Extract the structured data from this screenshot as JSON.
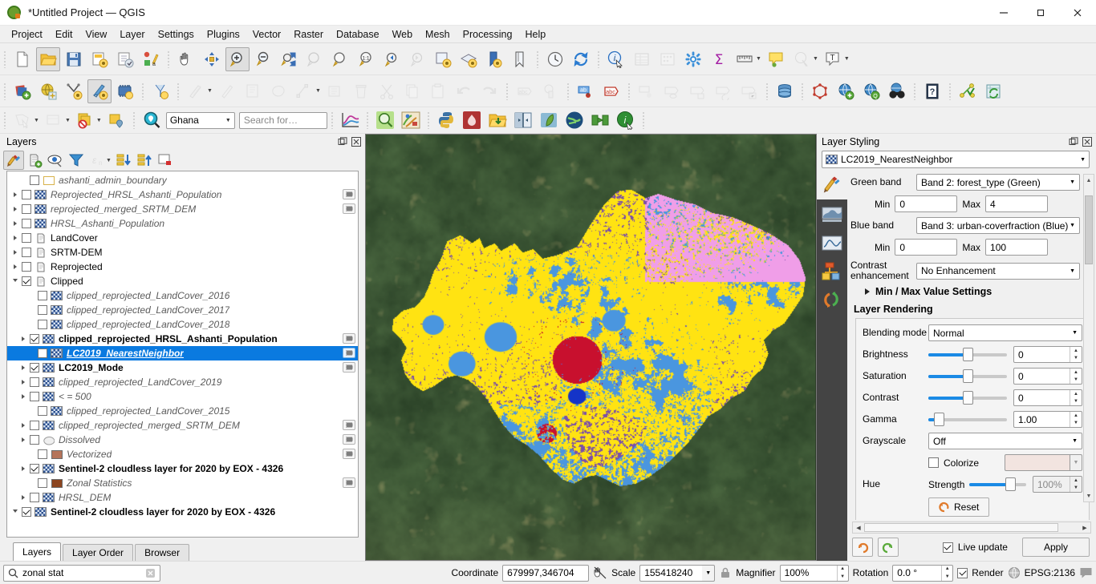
{
  "window": {
    "title": "*Untitled Project — QGIS",
    "minimize": "—",
    "maximize": "❐",
    "close": "✕"
  },
  "menubar": [
    {
      "label": "Project"
    },
    {
      "label": "Edit"
    },
    {
      "label": "View"
    },
    {
      "label": "Layer"
    },
    {
      "label": "Settings"
    },
    {
      "label": "Plugins"
    },
    {
      "label": "Vector"
    },
    {
      "label": "Raster"
    },
    {
      "label": "Database"
    },
    {
      "label": "Web"
    },
    {
      "label": "Mesh"
    },
    {
      "label": "Processing"
    },
    {
      "label": "Help"
    }
  ],
  "toolbar_project": [
    {
      "name": "new-project-icon",
      "tip": "New Project"
    },
    {
      "name": "open-project-icon",
      "tip": "Open Project"
    },
    {
      "name": "save-project-icon",
      "tip": "Save Project"
    },
    {
      "name": "save-project-as-icon",
      "tip": "Save Project As"
    },
    {
      "name": "new-print-layout-icon",
      "tip": "New Print Layout"
    },
    {
      "name": "style-manager-icon",
      "tip": "Style Manager"
    }
  ],
  "toolbar_navigation": [
    {
      "name": "pan-map-icon",
      "tip": "Pan Map"
    },
    {
      "name": "pan-to-selection-icon",
      "tip": "Pan Map to Selection"
    },
    {
      "name": "zoom-in-icon",
      "tip": "Zoom In",
      "active": true
    },
    {
      "name": "zoom-out-icon",
      "tip": "Zoom Out"
    },
    {
      "name": "zoom-full-icon",
      "tip": "Zoom Full"
    },
    {
      "name": "zoom-to-selection-icon",
      "tip": "Zoom to Selection",
      "disabled": true
    },
    {
      "name": "zoom-to-layer-icon",
      "tip": "Zoom to Layer"
    },
    {
      "name": "zoom-native-icon",
      "tip": "Zoom to Native Resolution"
    },
    {
      "name": "zoom-last-icon",
      "tip": "Zoom Last"
    },
    {
      "name": "zoom-next-icon",
      "tip": "Zoom Next",
      "disabled": true
    },
    {
      "name": "new-map-view-icon",
      "tip": "New Map View"
    },
    {
      "name": "new-3d-map-view-icon",
      "tip": "New 3D Map View"
    },
    {
      "name": "refresh-bookmark-icon",
      "tip": "Show Spatial Bookmarks"
    },
    {
      "name": "new-bookmark-icon",
      "tip": "New Spatial Bookmark"
    },
    {
      "name": "temporal-controller-icon",
      "tip": "Temporal Controller Panel"
    },
    {
      "name": "refresh-icon",
      "tip": "Refresh"
    }
  ],
  "toolbar_attributes": [
    {
      "name": "identify-features-icon",
      "tip": "Identify Features"
    },
    {
      "name": "open-attribute-table-icon",
      "tip": "Open Attribute Table",
      "disabled": true
    },
    {
      "name": "statistical-summary-icon",
      "tip": "Statistical Summary",
      "disabled": true
    },
    {
      "name": "processing-toolbox-icon",
      "tip": "Processing Toolbox"
    },
    {
      "name": "field-calculator-icon",
      "tip": "Field Calculator"
    },
    {
      "name": "measure-line-icon",
      "tip": "Measure Line"
    },
    {
      "name": "map-tips-icon",
      "tip": "Show Map Tips"
    },
    {
      "name": "select-features-icon",
      "tip": "Select Features",
      "disabled": true
    },
    {
      "name": "annotation-text-icon",
      "tip": "Text Annotation"
    }
  ],
  "toolbar_manage_layers": [
    {
      "name": "add-vector-layer-icon",
      "tip": "Add Vector Layer"
    },
    {
      "name": "add-raster-layer-icon",
      "tip": "Add Raster Layer"
    },
    {
      "name": "add-delimited-text-layer-icon",
      "tip": "Add Delimited Text Layer"
    },
    {
      "name": "new-shapefile-layer-icon",
      "tip": "New Shapefile Layer",
      "active": true
    },
    {
      "name": "add-mesh-layer-icon",
      "tip": "Add Mesh Layer"
    },
    {
      "name": "new-virtual-layer-icon",
      "tip": "New Virtual Layer"
    }
  ],
  "toolbar_digitizing": [
    {
      "name": "current-edits-icon",
      "tip": "Current Edits",
      "disabled": true
    },
    {
      "name": "toggle-editing-icon",
      "tip": "Toggle Editing",
      "disabled": true
    },
    {
      "name": "save-layer-edits-icon",
      "tip": "Save Layer Edits",
      "disabled": true
    },
    {
      "name": "add-polygon-feature-icon",
      "tip": "Add Polygon Feature",
      "disabled": true
    },
    {
      "name": "vertex-tool-icon",
      "tip": "Vertex Tool",
      "disabled": true
    },
    {
      "name": "modify-attributes-icon",
      "tip": "Modify Attributes of Features",
      "disabled": true
    },
    {
      "name": "delete-selected-icon",
      "tip": "Delete Selected",
      "disabled": true
    },
    {
      "name": "cut-features-icon",
      "tip": "Cut Features",
      "disabled": true
    },
    {
      "name": "copy-features-icon",
      "tip": "Copy Features",
      "disabled": true
    },
    {
      "name": "paste-features-icon",
      "tip": "Paste Features",
      "disabled": true
    },
    {
      "name": "undo-icon",
      "tip": "Undo",
      "disabled": true
    },
    {
      "name": "redo-icon",
      "tip": "Redo",
      "disabled": true
    }
  ],
  "toolbar_label": [
    {
      "name": "layer-labeling-options-icon",
      "tip": "Layer Labeling Options",
      "disabled": true
    },
    {
      "name": "layer-diagram-options-icon",
      "tip": "Layer Diagram Options",
      "disabled": true
    },
    {
      "name": "pin-labels-icon",
      "tip": "Pin Labels"
    },
    {
      "name": "highlight-pinned-labels-icon",
      "tip": "Highlight Pinned Labels"
    },
    {
      "name": "move-label-icon",
      "tip": "Move Label",
      "disabled": true
    },
    {
      "name": "show-hide-labels-icon",
      "tip": "Show/Hide Labels",
      "disabled": true
    },
    {
      "name": "rotate-label-icon",
      "tip": "Rotate Label",
      "disabled": true
    },
    {
      "name": "change-label-icon",
      "tip": "Change Label",
      "disabled": true
    },
    {
      "name": "label-properties-icon",
      "tip": "Label Properties",
      "disabled": true
    }
  ],
  "toolbar_database_web": [
    {
      "name": "database-manager-icon",
      "tip": "DB Manager"
    },
    {
      "name": "georeferencer-icon",
      "tip": "Georeferencer"
    },
    {
      "name": "metasearch-add-icon",
      "tip": "MetaSearch"
    },
    {
      "name": "qgis-globe-icon",
      "tip": "Globe"
    },
    {
      "name": "binoculars-icon",
      "tip": "Search"
    },
    {
      "name": "help-contents-icon",
      "tip": "Help Contents"
    },
    {
      "name": "plugins-manager-icon",
      "tip": "Plugins"
    },
    {
      "name": "refresh-layer-icon",
      "tip": "Refresh Layer"
    }
  ],
  "toolbar_selection": [
    {
      "name": "select-by-area-icon",
      "tip": "Select Features by Area",
      "disabled": true
    },
    {
      "name": "select-by-value-icon",
      "tip": "Select Features by Value",
      "disabled": true
    },
    {
      "name": "deselect-features-icon",
      "tip": "Deselect Features from All Layers"
    },
    {
      "name": "select-value-icon",
      "tip": "Select Value"
    }
  ],
  "gps_toolbar": {
    "locator_icon": "magnifier-place-icon",
    "region_selected": "Ghana",
    "search_placeholder": "Search for…"
  },
  "toolbar_plugins": [
    {
      "name": "plot-chart-icon",
      "tip": "Data Plotly"
    },
    {
      "name": "search-layers-icon",
      "tip": "Search Layers"
    },
    {
      "name": "qgis2web-icon",
      "tip": "qgis2web"
    },
    {
      "name": "python-console-icon",
      "tip": "Python Console"
    },
    {
      "name": "freehand-raster-icon",
      "tip": "Freehand Raster Georeferencer"
    },
    {
      "name": "open-data-source-icon",
      "tip": "Open Data File"
    },
    {
      "name": "swipe-tool-icon",
      "tip": "Map Swipe Tool"
    },
    {
      "name": "leaflet-icon",
      "tip": "Leaflet Map"
    },
    {
      "name": "qgis-globe-plugin-icon",
      "tip": "Globe Plugin"
    },
    {
      "name": "mmqgis-icon",
      "tip": "MMQGIS"
    },
    {
      "name": "about-plugin-icon",
      "tip": "About"
    }
  ],
  "layers_panel": {
    "title": "Layers",
    "undock_icon": "undock-icon",
    "close_icon": "close-icon",
    "toolbar": [
      {
        "name": "open-layer-styling-panel-icon",
        "tip": "Open the Layer Styling panel",
        "active": true
      },
      {
        "name": "add-group-icon",
        "tip": "Add Group"
      },
      {
        "name": "manage-map-themes-icon",
        "tip": "Manage Map Themes"
      },
      {
        "name": "filter-legend-icon",
        "tip": "Filter Legend"
      },
      {
        "name": "filter-legend-expression-icon",
        "tip": "Filter Legend by Expression",
        "disabled": true
      },
      {
        "name": "expand-all-icon",
        "tip": "Expand All"
      },
      {
        "name": "collapse-all-icon",
        "tip": "Collapse All"
      },
      {
        "name": "remove-layer-icon",
        "tip": "Remove Layer/Group"
      }
    ],
    "items": [
      {
        "label": "ashanti_admin_boundary",
        "icon": "vector-outline-swatch",
        "checked": false,
        "style": "italic",
        "indent": 1,
        "expander": "none",
        "dock": false
      },
      {
        "label": "Reprojected_HRSL_Ashanti_Population",
        "icon": "raster",
        "checked": false,
        "style": "italic",
        "indent": 0,
        "expander": "closed",
        "dock": true
      },
      {
        "label": "reprojected_merged_SRTM_DEM",
        "icon": "raster",
        "checked": false,
        "style": "italic",
        "indent": 0,
        "expander": "closed",
        "dock": true
      },
      {
        "label": "HRSL_Ashanti_Population",
        "icon": "raster",
        "checked": false,
        "style": "italic",
        "indent": 0,
        "expander": "closed",
        "dock": false
      },
      {
        "label": "LandCover",
        "icon": "group",
        "checked": false,
        "style": "plain",
        "indent": 0,
        "expander": "closed",
        "dock": false
      },
      {
        "label": "SRTM-DEM",
        "icon": "group",
        "checked": false,
        "style": "plain",
        "indent": 0,
        "expander": "closed",
        "dock": false
      },
      {
        "label": "Reprojected",
        "icon": "group",
        "checked": false,
        "style": "plain",
        "indent": 0,
        "expander": "closed",
        "dock": false
      },
      {
        "label": "Clipped",
        "icon": "group",
        "checked": true,
        "style": "plain",
        "indent": 0,
        "expander": "open",
        "dock": false
      },
      {
        "label": "clipped_reprojected_LandCover_2016",
        "icon": "raster",
        "checked": false,
        "style": "italic",
        "indent": 2,
        "expander": "none",
        "dock": false
      },
      {
        "label": "clipped_reprojected_LandCover_2017",
        "icon": "raster",
        "checked": false,
        "style": "italic",
        "indent": 2,
        "expander": "none",
        "dock": false
      },
      {
        "label": "clipped_reprojected_LandCover_2018",
        "icon": "raster",
        "checked": false,
        "style": "italic",
        "indent": 2,
        "expander": "none",
        "dock": false
      },
      {
        "label": "clipped_reprojected_HRSL_Ashanti_Population",
        "icon": "raster",
        "checked": true,
        "style": "bold",
        "indent": 1,
        "expander": "closed",
        "dock": true
      },
      {
        "label": "LC2019_NearestNeighbor",
        "icon": "raster",
        "checked": false,
        "style": "selected",
        "indent": 2,
        "expander": "none",
        "dock": true,
        "selected": true
      },
      {
        "label": "LC2019_Mode",
        "icon": "raster",
        "checked": true,
        "style": "bold",
        "indent": 1,
        "expander": "closed",
        "dock": true
      },
      {
        "label": "clipped_reprojected_LandCover_2019",
        "icon": "raster",
        "checked": false,
        "style": "italic",
        "indent": 1,
        "expander": "closed",
        "dock": false
      },
      {
        "label": "< = 500",
        "icon": "raster",
        "checked": false,
        "style": "italic",
        "indent": 1,
        "expander": "closed",
        "dock": false
      },
      {
        "label": "clipped_reprojected_LandCover_2015",
        "icon": "raster",
        "checked": false,
        "style": "italic",
        "indent": 2,
        "expander": "none",
        "dock": false
      },
      {
        "label": "clipped_reprojected_merged_SRTM_DEM",
        "icon": "raster",
        "checked": false,
        "style": "italic",
        "indent": 1,
        "expander": "closed",
        "dock": true
      },
      {
        "label": "Dissolved",
        "icon": "polygon-outline",
        "checked": false,
        "style": "italic",
        "indent": 1,
        "expander": "closed",
        "dock": true
      },
      {
        "label": "Vectorized",
        "icon": "swatch-brown-light",
        "checked": false,
        "style": "italic",
        "indent": 2,
        "expander": "none",
        "dock": true
      },
      {
        "label": "Sentinel-2 cloudless layer for 2020 by EOX - 4326",
        "icon": "raster",
        "checked": true,
        "style": "bold",
        "indent": 1,
        "expander": "closed",
        "dock": false
      },
      {
        "label": "Zonal Statistics",
        "icon": "swatch-brown-dark",
        "checked": false,
        "style": "italic",
        "indent": 2,
        "expander": "none",
        "dock": true
      },
      {
        "label": "HRSL_DEM",
        "icon": "raster",
        "checked": false,
        "style": "italic",
        "indent": 1,
        "expander": "closed",
        "dock": false
      },
      {
        "label": "Sentinel-2 cloudless layer for 2020 by EOX - 4326",
        "icon": "raster",
        "checked": true,
        "style": "bold",
        "indent": 0,
        "expander": "open",
        "dock": false
      }
    ],
    "tabs": [
      {
        "label": "Layers",
        "active": true
      },
      {
        "label": "Layer Order",
        "active": false
      },
      {
        "label": "Browser",
        "active": false
      }
    ]
  },
  "style_panel": {
    "title": "Layer Styling",
    "undock_icon": "undock-icon",
    "close_icon": "close-icon",
    "layer_selected": "LC2019_NearestNeighbor",
    "rail": [
      {
        "name": "symbology-icon",
        "active": false
      },
      {
        "name": "transparency-icon",
        "active": false
      },
      {
        "name": "histogram-icon",
        "active": false
      },
      {
        "name": "rendering-icon",
        "active": false
      },
      {
        "name": "undo-redo-history-icon",
        "active": false
      }
    ],
    "green_band": {
      "label": "Green band",
      "value": "Band 2: forest_type (Green)",
      "min_label": "Min",
      "min": "0",
      "max_label": "Max",
      "max": "4"
    },
    "blue_band": {
      "label": "Blue band",
      "value": "Band 3: urban-coverfraction (Blue)",
      "min_label": "Min",
      "min": "0",
      "max_label": "Max",
      "max": "100"
    },
    "contrast": {
      "label": "Contrast enhancement",
      "value": "No Enhancement"
    },
    "minmax_settings_label": "Min / Max Value Settings",
    "layer_rendering_label": "Layer Rendering",
    "blending": {
      "label": "Blending mode",
      "value": "Normal"
    },
    "brightness": {
      "label": "Brightness",
      "value": "0",
      "pct": 50
    },
    "saturation": {
      "label": "Saturation",
      "value": "0",
      "pct": 50
    },
    "contrast_slider": {
      "label": "Contrast",
      "value": "0",
      "pct": 50
    },
    "gamma": {
      "label": "Gamma",
      "value": "1.00",
      "pct": 10
    },
    "grayscale": {
      "label": "Grayscale",
      "value": "Off"
    },
    "colorize": {
      "label": "Colorize",
      "checked": false,
      "color": "#f2e4e0"
    },
    "hue": {
      "label": "Hue"
    },
    "strength": {
      "label": "Strength",
      "value": "100%",
      "pct": 72
    },
    "reset_label": "Reset",
    "live_update_label": "Live update",
    "live_update_checked": true,
    "apply_label": "Apply",
    "undo_icon": "undo-icon",
    "redo_icon": "redo-icon"
  },
  "statusbar": {
    "locator_placeholder": "zonal stat",
    "locator_icon": "search-icon",
    "locator_clear_icon": "clear-icon",
    "coordinate_label": "Coordinate",
    "coordinate_value": "679997,346704",
    "coordinate_toggle_icon": "capture-coordinate-icon",
    "scale_label": "Scale",
    "scale_value": "155418240",
    "lock_icon": "lock-scale-icon",
    "magnifier_label": "Magnifier",
    "magnifier_value": "100%",
    "rotation_label": "Rotation",
    "rotation_value": "0.0 °",
    "render_label": "Render",
    "render_checked": true,
    "crs_label": "EPSG:2136",
    "crs_icon": "globe-icon",
    "messages_icon": "messages-icon"
  },
  "map": {
    "name": "map-canvas",
    "basemap_color": "#2f4430",
    "landcover_colors": {
      "crops_yellow": "#ffe312",
      "shrub_blue": "#4a96df",
      "forest_pink": "#f09ee8",
      "urban_red": "#c8102e",
      "water_darkblue": "#1434c8",
      "purple_mix": "#7b4fa8"
    }
  }
}
